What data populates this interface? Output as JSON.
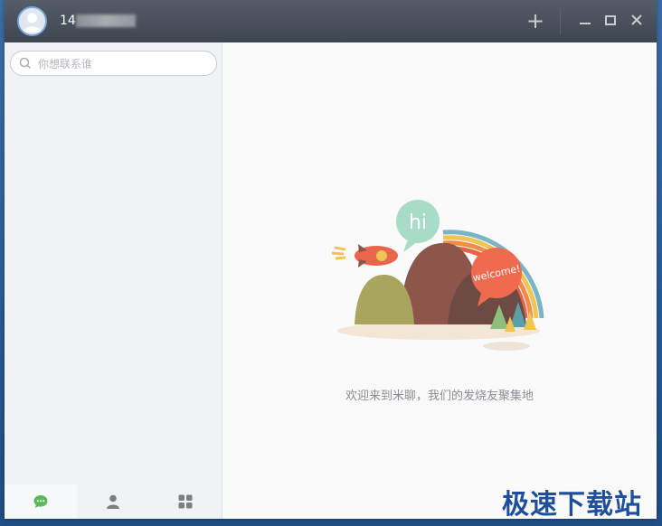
{
  "titlebar": {
    "username": "14",
    "add_label": "+",
    "minimize_label": "–",
    "maximize_label": "□",
    "close_label": "✕"
  },
  "sidebar": {
    "search_placeholder": "你想联系谁",
    "nav_items": [
      {
        "icon": "chat-bubble-icon",
        "active": true
      },
      {
        "icon": "contacts-person-icon",
        "active": false
      },
      {
        "icon": "apps-grid-icon",
        "active": false
      }
    ]
  },
  "main": {
    "illustration": {
      "hi_text": "hi",
      "welcome_text": "welcome!"
    },
    "welcome_message": "欢迎来到米聊，我们的发烧友聚集地"
  },
  "watermark": "极速下载站",
  "colors": {
    "titlebar": "#4a525c",
    "sidebar_bg": "#f1f2f4",
    "main_bg": "#fafafa",
    "accent_green": "#5cb85c",
    "hi_bubble": "#a8dcc8",
    "welcome_bubble": "#f06a4f",
    "mountain_brown": "#8c564b",
    "hill_olive": "#a8a55e"
  }
}
